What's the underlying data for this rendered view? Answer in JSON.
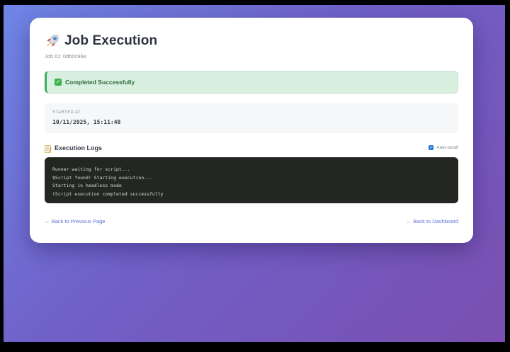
{
  "page": {
    "title": "Job Execution",
    "job_id": "Job ID: 0db0c96e",
    "icon": "rocket-icon"
  },
  "status": {
    "text": "Completed Successfully",
    "icon": "check-icon",
    "color": "#3fae5c"
  },
  "info": {
    "started_label": "STARTED AT",
    "started_value": "10/11/2025, 15:11:48"
  },
  "logs": {
    "title": "Execution Logs",
    "icon": "memo-icon",
    "autoscroll_label": "Auto-scroll",
    "autoscroll_checked": true,
    "lines": [
      "Runner waiting for script...",
      "$Script found! Starting execution...",
      "Starting in headless mode",
      "(Script execution completed successfully"
    ]
  },
  "nav": {
    "back_previous": "← Back to Previous Page",
    "back_dashboard": "← Back to Dashboard"
  },
  "colors": {
    "accent": "#5b72d6",
    "background_gradient_start": "#6f86e6",
    "background_gradient_end": "#7a4fb0",
    "console_bg": "#232621"
  }
}
